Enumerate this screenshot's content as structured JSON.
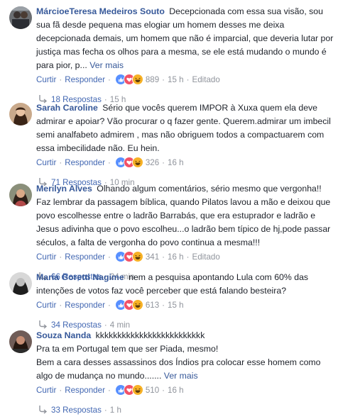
{
  "comments": [
    {
      "author": "MárcioeTeresa Medeiros Souto",
      "text": "Decepcionada com essa sua visão, sou sua fã desde pequena mas elogiar um homem desses me deixa decepcionada demais, um homem que não é imparcial, que deveria lutar por justiça mas fecha os olhos para a mesma, se ele está mudando o mundo é para pior, p...",
      "see_more": "Ver mais",
      "like": "Curtir",
      "reply": "Responder",
      "reaction_count": "889",
      "time": "15 h",
      "edited": "Editado",
      "replies_label": "18 Respostas",
      "replies_time": "15 h"
    },
    {
      "author": "Sarah Caroline",
      "text": "Sério que vocês querem IMPOR à Xuxa quem ela deve admirar e apoiar? Vão procurar o q fazer gente. Querem.admirar um imbecil semi analfabeto admirem , mas não obriguem todos a compactuarem com essa imbecilidade não. Eu hein.",
      "see_more": "",
      "like": "Curtir",
      "reply": "Responder",
      "reaction_count": "326",
      "time": "16 h",
      "edited": "",
      "replies_label": "71 Respostas",
      "replies_time": "10 min"
    },
    {
      "author": "Merilyn Alves",
      "text": "Olhando algum comentários, sério mesmo que vergonha!! Faz lembrar da passagem bíblica, quando Pilatos lavou a mão e deixou que povo escolhesse entre o ladrão Barrabás, que era estuprador e ladrão e Jesus adivinha que o povo escolheu...o ladrão bem típico de hj,pode passar séculos, a falta de vergonha do povo continua a mesma!!!",
      "see_more": "",
      "like": "Curtir",
      "reply": "Responder",
      "reaction_count": "341",
      "time": "16 h",
      "edited": "Editado",
      "replies_label": "66 Respostas",
      "replies_time": "24 min"
    },
    {
      "author": "Maria Goretti Nagime",
      "text": "nem a pesquisa apontando Lula com 60% das intenções de votos faz você perceber que está falando besteira?",
      "see_more": "",
      "like": "Curtir",
      "reply": "Responder",
      "reaction_count": "613",
      "time": "15 h",
      "edited": "",
      "replies_label": "34 Respostas",
      "replies_time": "4 min"
    },
    {
      "author": "Souza Nanda",
      "text": "kkkkkkkkkkkkkkkkkkkkkkkkk\nPra ta em Portugal tem que ser Piada, mesmo!\nBem a cara desses assassinos dos Índios pra colocar esse homem como algo de mudança no mundo.......",
      "see_more": "Ver mais",
      "like": "Curtir",
      "reply": "Responder",
      "reaction_count": "510",
      "time": "16 h",
      "edited": "",
      "replies_label": "33 Respostas",
      "replies_time": "1 h"
    }
  ],
  "colors": {
    "link": "#365899",
    "action": "#4267b2",
    "meta": "#90949c",
    "like_blue": "#5890ff",
    "love_red": "#f25268",
    "haha_yellow": "#f7b125"
  },
  "icons": [
    "like-reaction-icon",
    "love-reaction-icon",
    "haha-reaction-icon",
    "reply-arrow-icon"
  ]
}
